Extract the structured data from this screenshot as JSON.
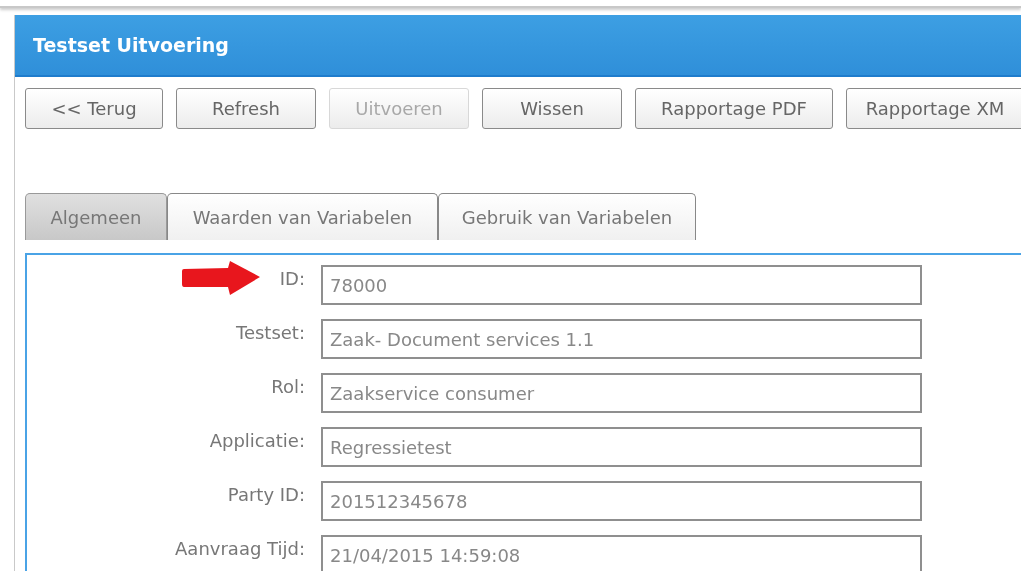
{
  "window": {
    "title": "Testset Uitvoering"
  },
  "buttons": [
    {
      "label": "<< Terug",
      "disabled": false
    },
    {
      "label": "Refresh",
      "disabled": false
    },
    {
      "label": "Uitvoeren",
      "disabled": true
    },
    {
      "label": "Wissen",
      "disabled": false
    },
    {
      "label": "Rapportage PDF",
      "disabled": false
    },
    {
      "label": "Rapportage XM",
      "disabled": false
    }
  ],
  "tabs": [
    {
      "label": "Algemeen",
      "selected": true
    },
    {
      "label": "Waarden van Variabelen",
      "selected": false
    },
    {
      "label": "Gebruik van Variabelen",
      "selected": false
    }
  ],
  "fields": [
    {
      "label": "ID:",
      "value": "78000",
      "highlighted": true
    },
    {
      "label": "Testset:",
      "value": "Zaak- Document services 1.1",
      "highlighted": false
    },
    {
      "label": "Rol:",
      "value": "Zaakservice consumer",
      "highlighted": false
    },
    {
      "label": "Applicatie:",
      "value": "Regressietest",
      "highlighted": false
    },
    {
      "label": "Party ID:",
      "value": "201512345678",
      "highlighted": false
    },
    {
      "label": "Aanvraag Tijd:",
      "value": "21/04/2015 14:59:08",
      "highlighted": false
    }
  ]
}
